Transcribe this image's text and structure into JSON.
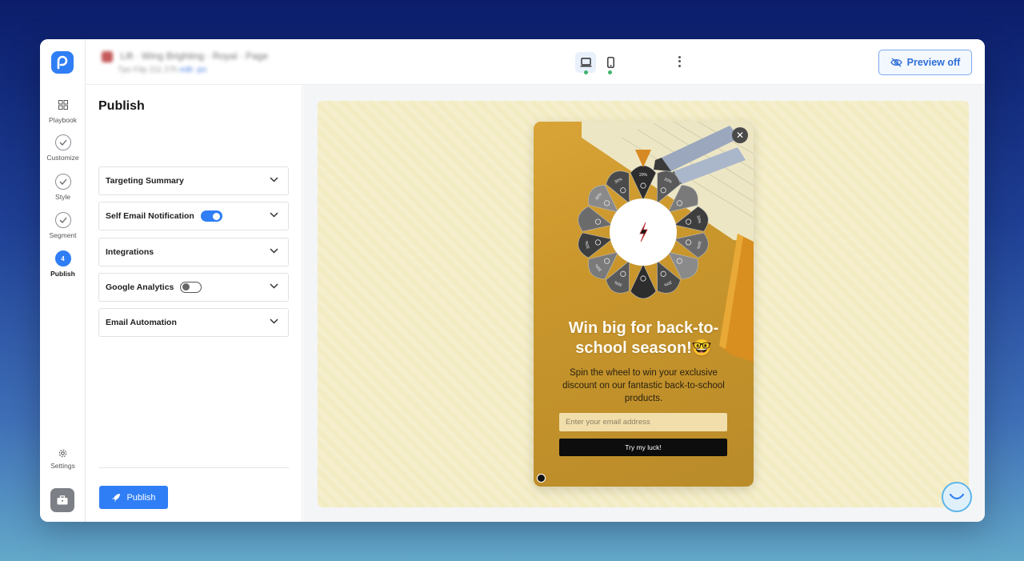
{
  "header": {
    "title_blurred": "Lift · Wing Brighting · Royal · Page",
    "subtitle_blurred": "Tpo Fitp 211 27h",
    "subtitle_link_blurred": "edit ·po",
    "preview_label": "Preview off"
  },
  "rail": {
    "items": [
      {
        "label": "Playbook"
      },
      {
        "label": "Customize"
      },
      {
        "label": "Style"
      },
      {
        "label": "Segment"
      },
      {
        "label": "Publish",
        "step": "4"
      }
    ],
    "settings_label": "Settings"
  },
  "panel": {
    "title": "Publish",
    "sections": [
      {
        "label": "Targeting Summary"
      },
      {
        "label": "Self Email Notification",
        "toggle": true
      },
      {
        "label": "Integrations"
      },
      {
        "label": "Google Analytics",
        "toggle": false
      },
      {
        "label": "Email Automation"
      }
    ],
    "publish_button": "Publish"
  },
  "popup": {
    "wheel_segments": [
      "20%",
      "20%",
      "",
      "30%",
      "30%",
      "",
      "30%",
      "",
      "30%",
      "30%",
      "30%",
      "",
      "30%",
      "30%"
    ],
    "headline": "Win big for back-to-school season!🤓",
    "subline": "Spin the wheel to win your exclusive discount on our fantastic back-to-school products.",
    "email_placeholder": "Enter your email address",
    "cta": "Try my luck!",
    "close_symbol": "✕"
  },
  "colors": {
    "accent": "#2f7ef5",
    "canvas_bg": "#f3ebc2",
    "popup_bg": "#c9962c",
    "status_dot": "#3fb36b"
  }
}
